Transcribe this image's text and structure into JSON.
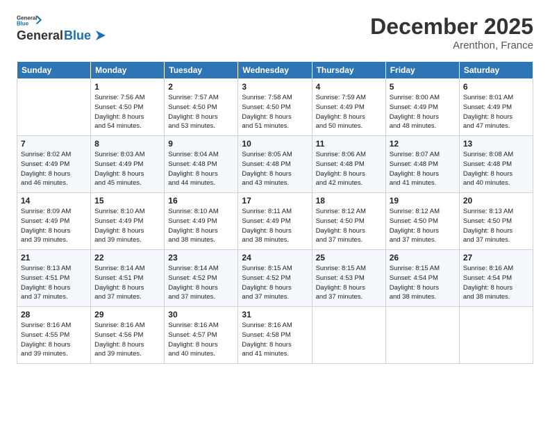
{
  "header": {
    "logo_general": "General",
    "logo_blue": "Blue",
    "month": "December 2025",
    "location": "Arenthon, France"
  },
  "days_of_week": [
    "Sunday",
    "Monday",
    "Tuesday",
    "Wednesday",
    "Thursday",
    "Friday",
    "Saturday"
  ],
  "weeks": [
    [
      {
        "day": "",
        "info": ""
      },
      {
        "day": "1",
        "info": "Sunrise: 7:56 AM\nSunset: 4:50 PM\nDaylight: 8 hours\nand 54 minutes."
      },
      {
        "day": "2",
        "info": "Sunrise: 7:57 AM\nSunset: 4:50 PM\nDaylight: 8 hours\nand 53 minutes."
      },
      {
        "day": "3",
        "info": "Sunrise: 7:58 AM\nSunset: 4:50 PM\nDaylight: 8 hours\nand 51 minutes."
      },
      {
        "day": "4",
        "info": "Sunrise: 7:59 AM\nSunset: 4:49 PM\nDaylight: 8 hours\nand 50 minutes."
      },
      {
        "day": "5",
        "info": "Sunrise: 8:00 AM\nSunset: 4:49 PM\nDaylight: 8 hours\nand 48 minutes."
      },
      {
        "day": "6",
        "info": "Sunrise: 8:01 AM\nSunset: 4:49 PM\nDaylight: 8 hours\nand 47 minutes."
      }
    ],
    [
      {
        "day": "7",
        "info": "Sunrise: 8:02 AM\nSunset: 4:49 PM\nDaylight: 8 hours\nand 46 minutes."
      },
      {
        "day": "8",
        "info": "Sunrise: 8:03 AM\nSunset: 4:49 PM\nDaylight: 8 hours\nand 45 minutes."
      },
      {
        "day": "9",
        "info": "Sunrise: 8:04 AM\nSunset: 4:48 PM\nDaylight: 8 hours\nand 44 minutes."
      },
      {
        "day": "10",
        "info": "Sunrise: 8:05 AM\nSunset: 4:48 PM\nDaylight: 8 hours\nand 43 minutes."
      },
      {
        "day": "11",
        "info": "Sunrise: 8:06 AM\nSunset: 4:48 PM\nDaylight: 8 hours\nand 42 minutes."
      },
      {
        "day": "12",
        "info": "Sunrise: 8:07 AM\nSunset: 4:48 PM\nDaylight: 8 hours\nand 41 minutes."
      },
      {
        "day": "13",
        "info": "Sunrise: 8:08 AM\nSunset: 4:48 PM\nDaylight: 8 hours\nand 40 minutes."
      }
    ],
    [
      {
        "day": "14",
        "info": "Sunrise: 8:09 AM\nSunset: 4:49 PM\nDaylight: 8 hours\nand 39 minutes."
      },
      {
        "day": "15",
        "info": "Sunrise: 8:10 AM\nSunset: 4:49 PM\nDaylight: 8 hours\nand 39 minutes."
      },
      {
        "day": "16",
        "info": "Sunrise: 8:10 AM\nSunset: 4:49 PM\nDaylight: 8 hours\nand 38 minutes."
      },
      {
        "day": "17",
        "info": "Sunrise: 8:11 AM\nSunset: 4:49 PM\nDaylight: 8 hours\nand 38 minutes."
      },
      {
        "day": "18",
        "info": "Sunrise: 8:12 AM\nSunset: 4:50 PM\nDaylight: 8 hours\nand 37 minutes."
      },
      {
        "day": "19",
        "info": "Sunrise: 8:12 AM\nSunset: 4:50 PM\nDaylight: 8 hours\nand 37 minutes."
      },
      {
        "day": "20",
        "info": "Sunrise: 8:13 AM\nSunset: 4:50 PM\nDaylight: 8 hours\nand 37 minutes."
      }
    ],
    [
      {
        "day": "21",
        "info": "Sunrise: 8:13 AM\nSunset: 4:51 PM\nDaylight: 8 hours\nand 37 minutes."
      },
      {
        "day": "22",
        "info": "Sunrise: 8:14 AM\nSunset: 4:51 PM\nDaylight: 8 hours\nand 37 minutes."
      },
      {
        "day": "23",
        "info": "Sunrise: 8:14 AM\nSunset: 4:52 PM\nDaylight: 8 hours\nand 37 minutes."
      },
      {
        "day": "24",
        "info": "Sunrise: 8:15 AM\nSunset: 4:52 PM\nDaylight: 8 hours\nand 37 minutes."
      },
      {
        "day": "25",
        "info": "Sunrise: 8:15 AM\nSunset: 4:53 PM\nDaylight: 8 hours\nand 37 minutes."
      },
      {
        "day": "26",
        "info": "Sunrise: 8:15 AM\nSunset: 4:54 PM\nDaylight: 8 hours\nand 38 minutes."
      },
      {
        "day": "27",
        "info": "Sunrise: 8:16 AM\nSunset: 4:54 PM\nDaylight: 8 hours\nand 38 minutes."
      }
    ],
    [
      {
        "day": "28",
        "info": "Sunrise: 8:16 AM\nSunset: 4:55 PM\nDaylight: 8 hours\nand 39 minutes."
      },
      {
        "day": "29",
        "info": "Sunrise: 8:16 AM\nSunset: 4:56 PM\nDaylight: 8 hours\nand 39 minutes."
      },
      {
        "day": "30",
        "info": "Sunrise: 8:16 AM\nSunset: 4:57 PM\nDaylight: 8 hours\nand 40 minutes."
      },
      {
        "day": "31",
        "info": "Sunrise: 8:16 AM\nSunset: 4:58 PM\nDaylight: 8 hours\nand 41 minutes."
      },
      {
        "day": "",
        "info": ""
      },
      {
        "day": "",
        "info": ""
      },
      {
        "day": "",
        "info": ""
      }
    ]
  ]
}
